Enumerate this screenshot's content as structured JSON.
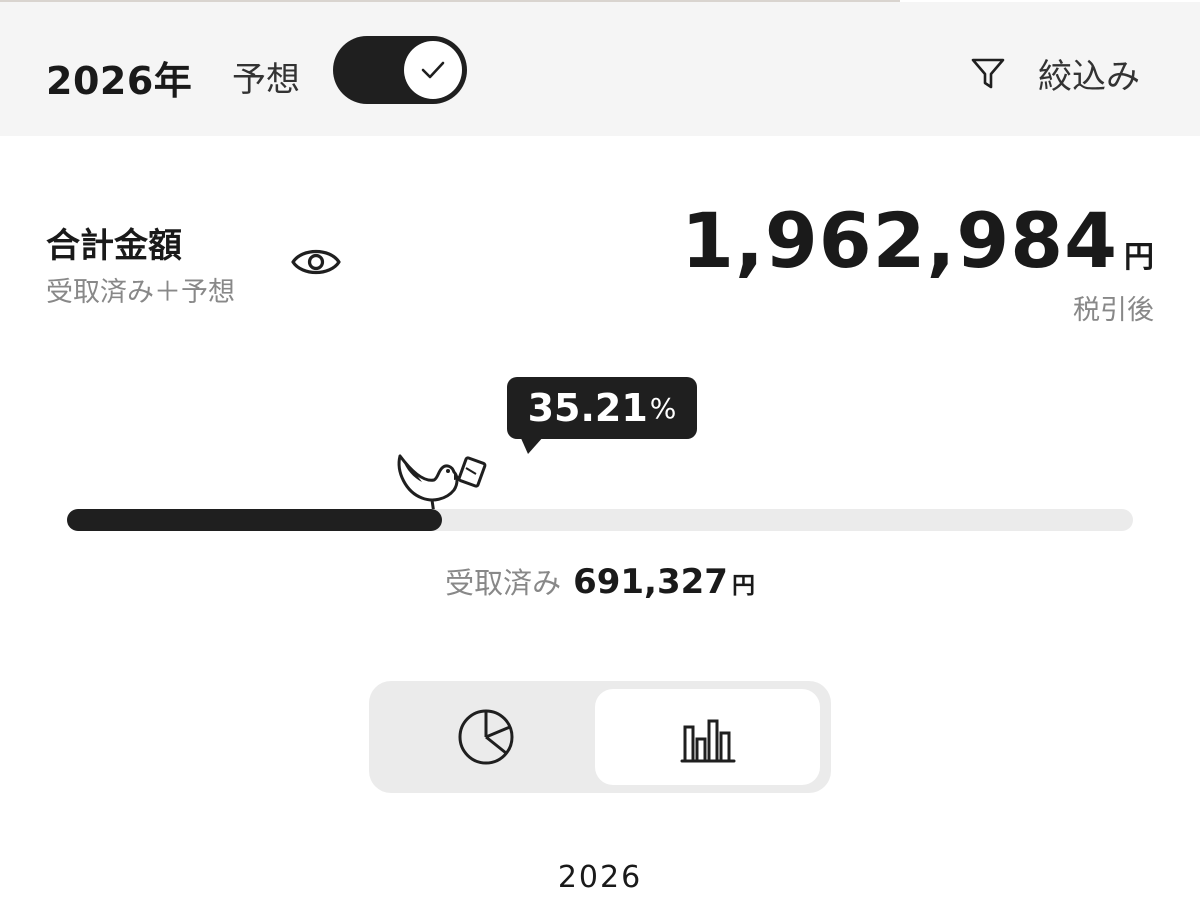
{
  "header": {
    "year": "2026年",
    "forecast_label": "予想",
    "forecast_enabled": true,
    "filter_label": "絞込み"
  },
  "summary": {
    "title": "合計金額",
    "subtitle": "受取済み＋予想",
    "amount": "1,962,984",
    "unit": "円",
    "tax_note": "税引後"
  },
  "progress": {
    "percent_value": "35.21",
    "percent_sign": "%",
    "fraction": 0.3521,
    "received_label": "受取済み",
    "received_value": "691,327",
    "received_unit": "円"
  },
  "view_toggle": {
    "options": [
      "pie-chart",
      "bar-chart"
    ],
    "selected": "bar-chart"
  },
  "chart": {
    "year_label": "2026"
  },
  "colors": {
    "dark": "#1f1f1f",
    "track": "#ebebeb",
    "muted_text": "#888888"
  }
}
